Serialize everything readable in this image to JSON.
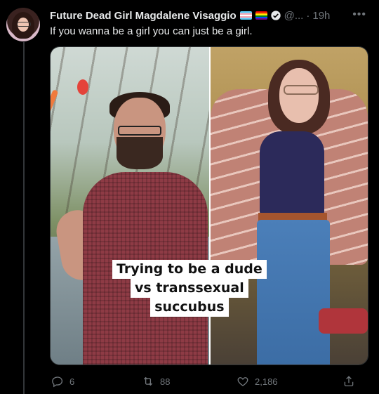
{
  "author": {
    "display_name": "Future Dead Girl Magdalene Visaggio",
    "handle": "@...",
    "timestamp": "19h"
  },
  "tweet": {
    "text": "If you wanna be a girl you can just be a girl."
  },
  "media": {
    "caption_lines": [
      "Trying to be a dude",
      "vs transsexual",
      "succubus"
    ]
  },
  "actions": {
    "replies": "6",
    "retweets": "88",
    "likes": "2,186"
  },
  "icons": {
    "more": "more-icon",
    "verified": "verified-icon",
    "reply": "reply-icon",
    "retweet": "retweet-icon",
    "like": "heart-icon",
    "share": "share-icon"
  },
  "colors": {
    "background": "#000000",
    "text": "#e7e9ea",
    "muted": "#71767b"
  }
}
